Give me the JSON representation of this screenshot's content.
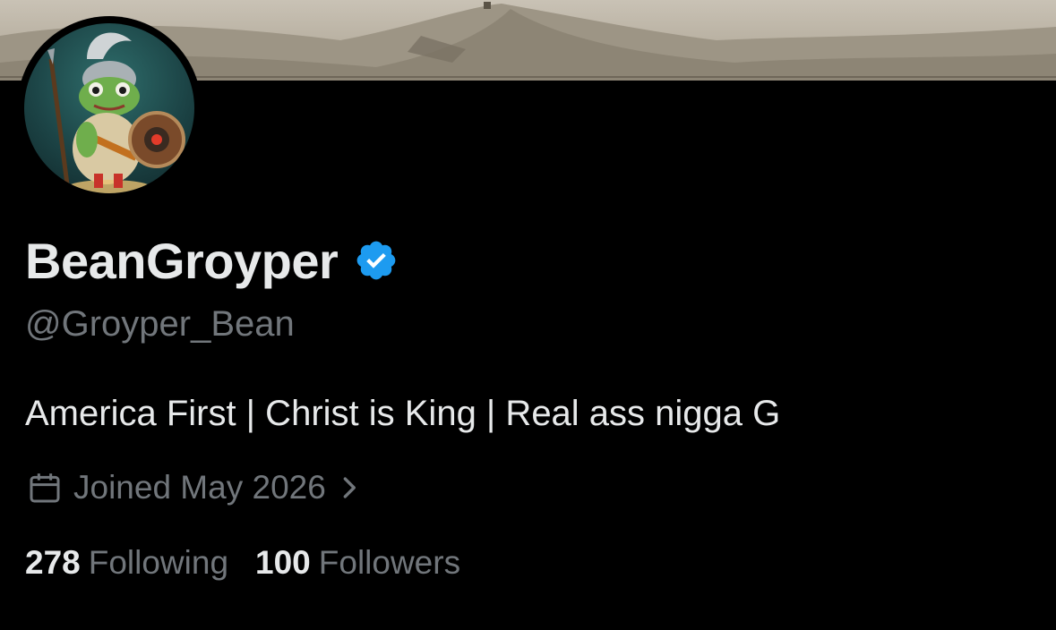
{
  "profile": {
    "display_name": "BeanGroyper",
    "handle": "@Groyper_Bean",
    "bio": "America First | Christ is King | Real ass nigga G",
    "joined": "Joined May 2026",
    "verified": true
  },
  "stats": {
    "following_count": "278",
    "following_label": "Following",
    "followers_count": "100",
    "followers_label": "Followers"
  },
  "colors": {
    "background": "#000000",
    "primary_text": "#e7e9ea",
    "secondary_text": "#71767b",
    "verified_blue": "#1d9bf0"
  },
  "icons": {
    "verified": "verified-badge-icon",
    "calendar": "calendar-icon",
    "chevron": "chevron-right-icon"
  }
}
